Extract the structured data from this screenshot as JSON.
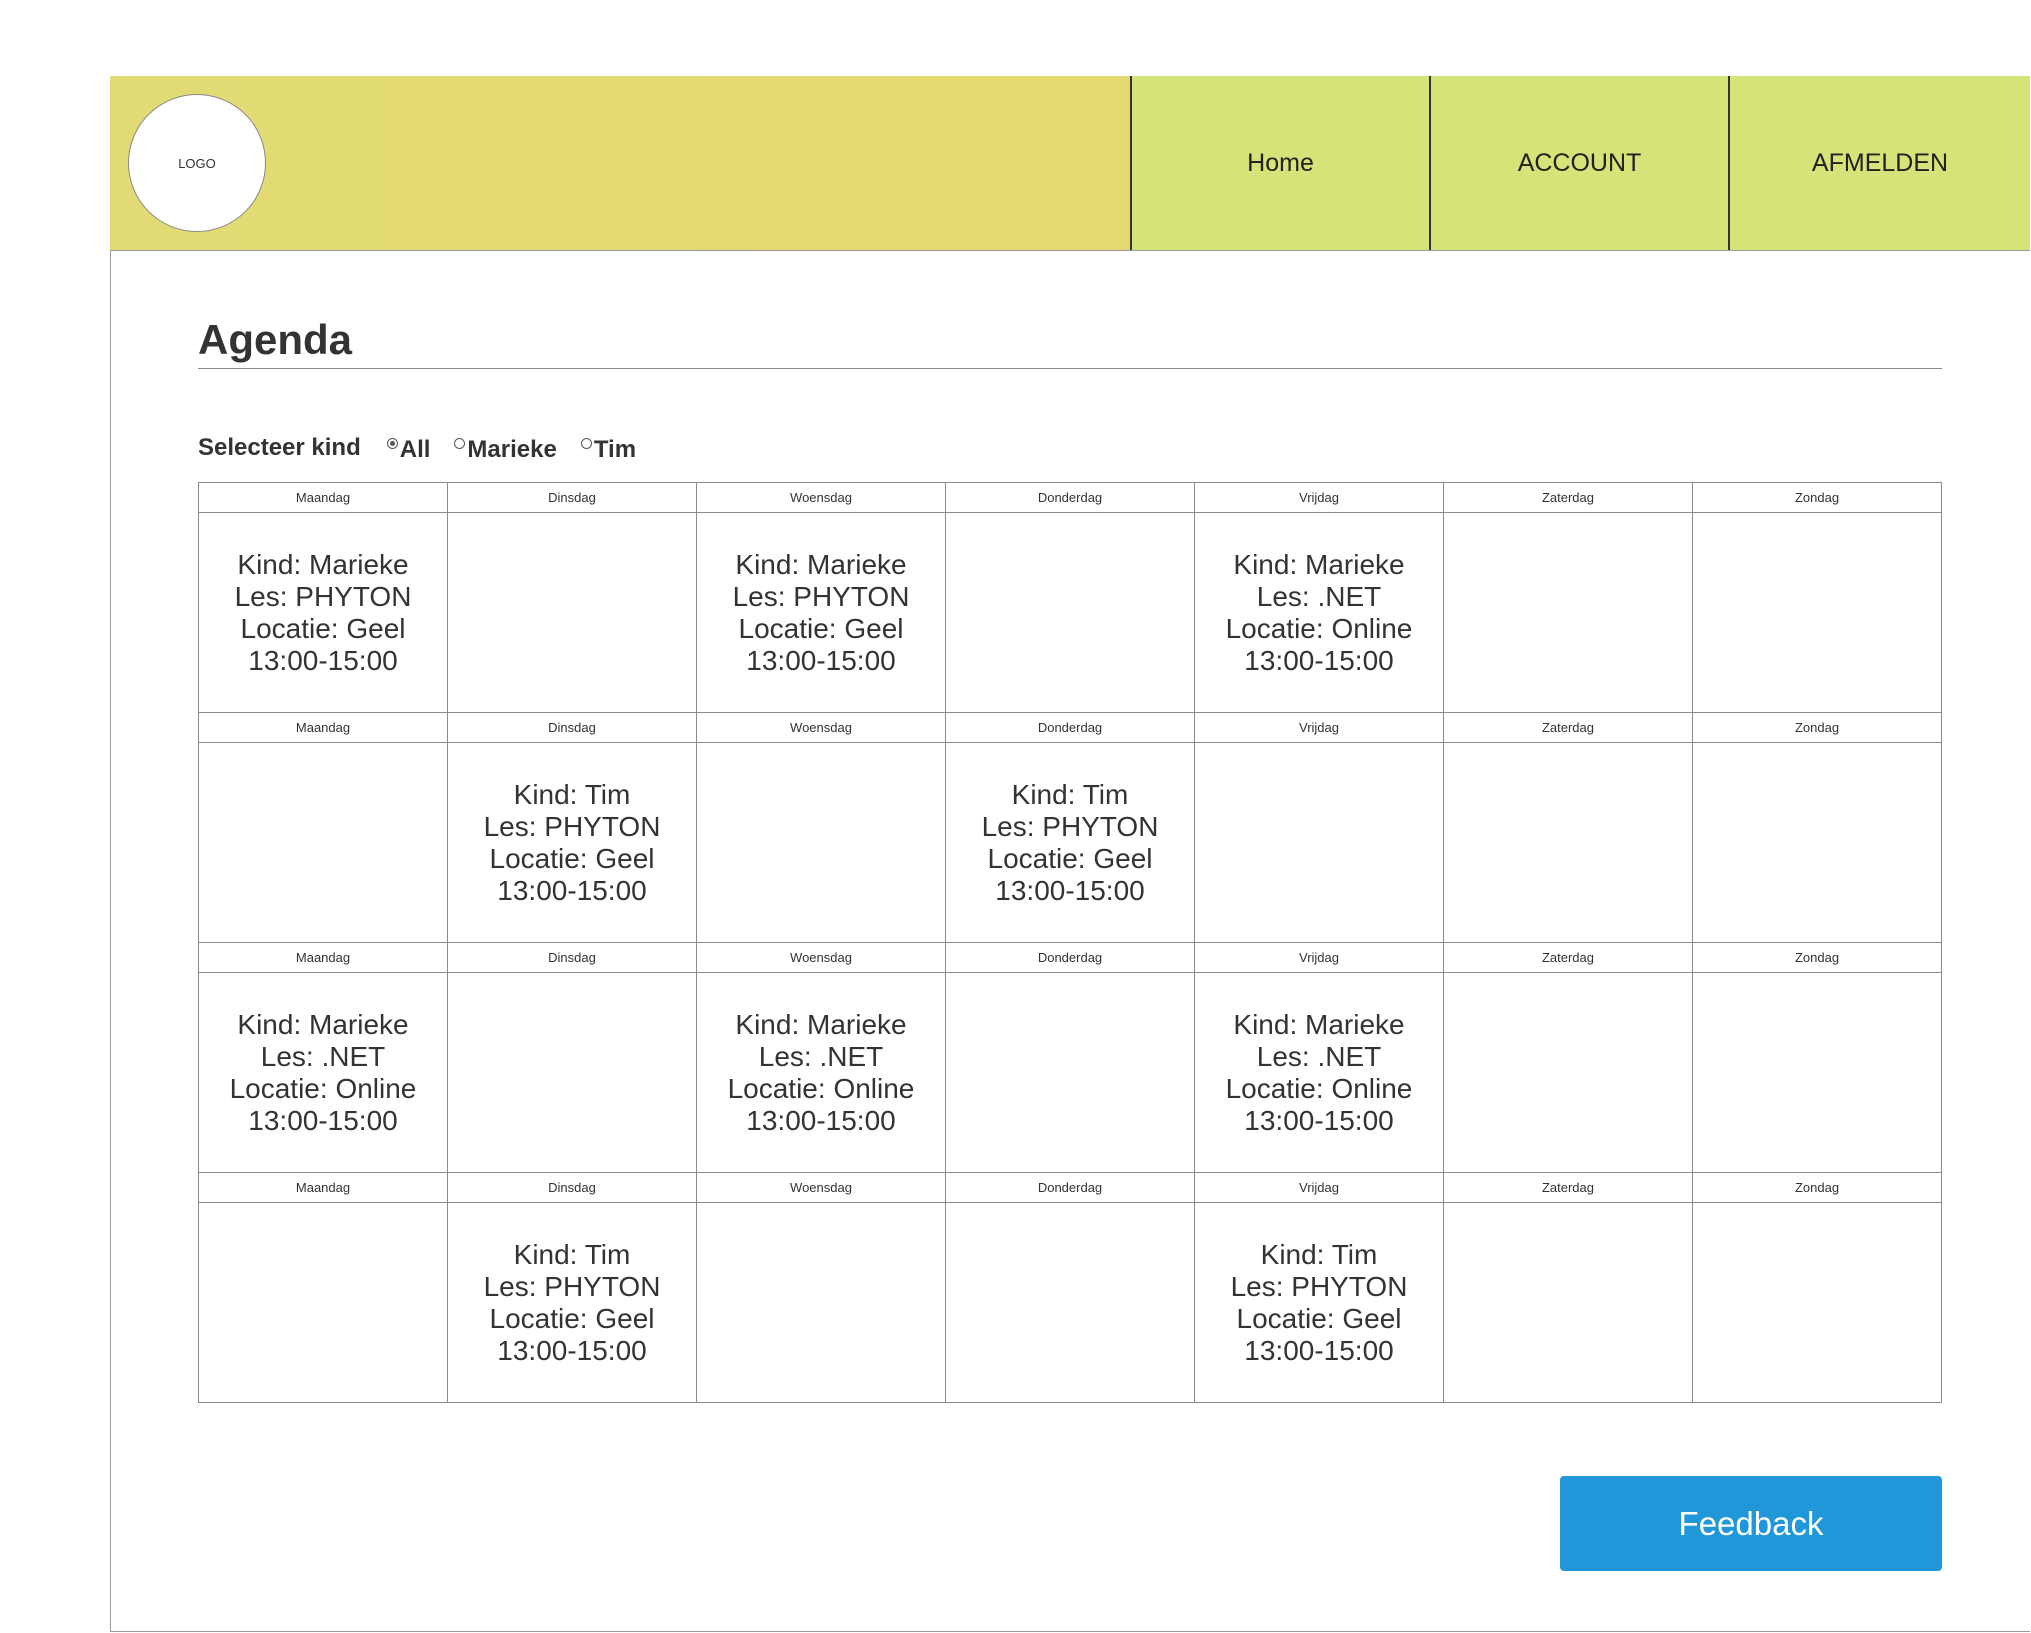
{
  "header": {
    "logo_text": "LOGO",
    "nav": [
      "Home",
      "ACCOUNT",
      "AFMELDEN"
    ]
  },
  "page_title": "Agenda",
  "filter": {
    "label": "Selecteer kind",
    "options": [
      "All",
      "Marieke",
      "Tim"
    ],
    "selected": "All"
  },
  "days": [
    "Maandag",
    "Dinsdag",
    "Woensdag",
    "Donderdag",
    "Vrijdag",
    "Zaterdag",
    "Zondag"
  ],
  "weeks": [
    {
      "events": [
        {
          "kind": "Kind: Marieke",
          "les": "Les: PHYTON",
          "locatie": "Locatie: Geel",
          "tijd": "13:00-15:00"
        },
        null,
        {
          "kind": "Kind: Marieke",
          "les": "Les: PHYTON",
          "locatie": "Locatie: Geel",
          "tijd": "13:00-15:00"
        },
        null,
        {
          "kind": "Kind: Marieke",
          "les": "Les: .NET",
          "locatie": "Locatie: Online",
          "tijd": "13:00-15:00"
        },
        null,
        null
      ]
    },
    {
      "events": [
        null,
        {
          "kind": "Kind: Tim",
          "les": "Les: PHYTON",
          "locatie": "Locatie: Geel",
          "tijd": "13:00-15:00"
        },
        null,
        {
          "kind": "Kind: Tim",
          "les": "Les: PHYTON",
          "locatie": "Locatie: Geel",
          "tijd": "13:00-15:00"
        },
        null,
        null,
        null
      ]
    },
    {
      "events": [
        {
          "kind": "Kind: Marieke",
          "les": "Les: .NET",
          "locatie": "Locatie: Online",
          "tijd": "13:00-15:00"
        },
        null,
        {
          "kind": "Kind: Marieke",
          "les": "Les: .NET",
          "locatie": "Locatie: Online",
          "tijd": "13:00-15:00"
        },
        null,
        {
          "kind": "Kind: Marieke",
          "les": "Les: .NET",
          "locatie": "Locatie: Online",
          "tijd": "13:00-15:00"
        },
        null,
        null
      ]
    },
    {
      "events": [
        null,
        {
          "kind": "Kind: Tim",
          "les": "Les: PHYTON",
          "locatie": "Locatie: Geel",
          "tijd": "13:00-15:00"
        },
        null,
        null,
        {
          "kind": "Kind: Tim",
          "les": "Les: PHYTON",
          "locatie": "Locatie: Geel",
          "tijd": "13:00-15:00"
        },
        null,
        null
      ]
    }
  ],
  "feedback_label": "Feedback",
  "colors": {
    "header_left": "#e2da74",
    "nav_bg": "#d6e378",
    "feedback_bg": "#1f97d8"
  }
}
